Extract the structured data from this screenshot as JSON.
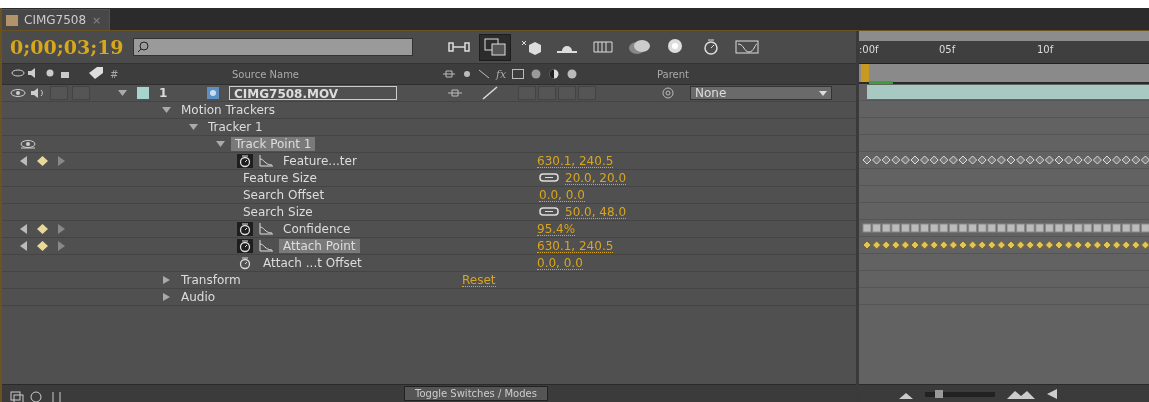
{
  "tab": {
    "title": "CIMG7508",
    "close": "×"
  },
  "timecode": "0;00;03;19",
  "toolbar": [
    {
      "kind": "flowchart",
      "selected": false
    },
    {
      "kind": "mini-comp",
      "selected": true
    },
    {
      "kind": "draft-3d",
      "selected": false
    },
    {
      "kind": "shy",
      "selected": false
    },
    {
      "kind": "frame-blend",
      "selected": false
    },
    {
      "kind": "motion-blur",
      "selected": false
    },
    {
      "kind": "brainstorm",
      "selected": false
    },
    {
      "kind": "stopwatch",
      "selected": false
    },
    {
      "kind": "graph",
      "selected": false
    }
  ],
  "columns": {
    "effects": "fx",
    "number": "#",
    "source_name": "Source Name",
    "parent": "Parent"
  },
  "layer": {
    "number": "1",
    "name": "CIMG7508.MOV",
    "parent": "None",
    "expanded": true,
    "solo": false,
    "lock": false,
    "switches": [
      {
        "checked": false
      },
      {
        "checked": false
      },
      {
        "checked": false
      },
      {
        "checked": false
      }
    ]
  },
  "properties": [
    {
      "kind": "group",
      "label": "Motion Trackers",
      "expanded": true,
      "selected": false,
      "children": [
        {
          "kind": "group",
          "label": "Tracker 1",
          "expanded": true,
          "selected": false,
          "children": [
            {
              "kind": "group",
              "label": "Track Point 1",
              "expanded": true,
              "selected": true,
              "visible": true,
              "children": [
                {
                  "kind": "animated",
                  "label": "Feature...ter",
                  "value": "630.1, 240.5",
                  "keyframes": {
                    "kind": "diamond"
                  },
                  "selected": false
                },
                {
                  "kind": "static",
                  "label": "Feature Size",
                  "value": "20.0, 20.0",
                  "linked": true,
                  "selected": false
                },
                {
                  "kind": "static",
                  "label": "Search Offset",
                  "value": "0.0, 0.0",
                  "linked": false,
                  "selected": false
                },
                {
                  "kind": "static",
                  "label": "Search Size",
                  "value": "50.0, 48.0",
                  "linked": true,
                  "selected": false
                },
                {
                  "kind": "animated",
                  "label": "Confidence",
                  "value": "95.4%",
                  "keyframes": {
                    "kind": "bar"
                  },
                  "selected": false
                },
                {
                  "kind": "animated",
                  "label": "Attach Point",
                  "value": "630.1, 240.5",
                  "keyframes": {
                    "kind": "gold"
                  },
                  "selected": true
                },
                {
                  "kind": "stopwatch",
                  "label": "Attach ...t Offset",
                  "value": "0.0, 0.0",
                  "selected": false
                }
              ]
            }
          ]
        }
      ]
    },
    {
      "kind": "group",
      "label": "Transform",
      "value": "Reset",
      "expanded": false,
      "selected": false
    },
    {
      "kind": "group",
      "label": "Audio",
      "expanded": false,
      "selected": false
    }
  ],
  "ruler": [
    ":00f",
    "05f",
    "10f"
  ],
  "toggle_button": "Toggle Switches / Modes"
}
